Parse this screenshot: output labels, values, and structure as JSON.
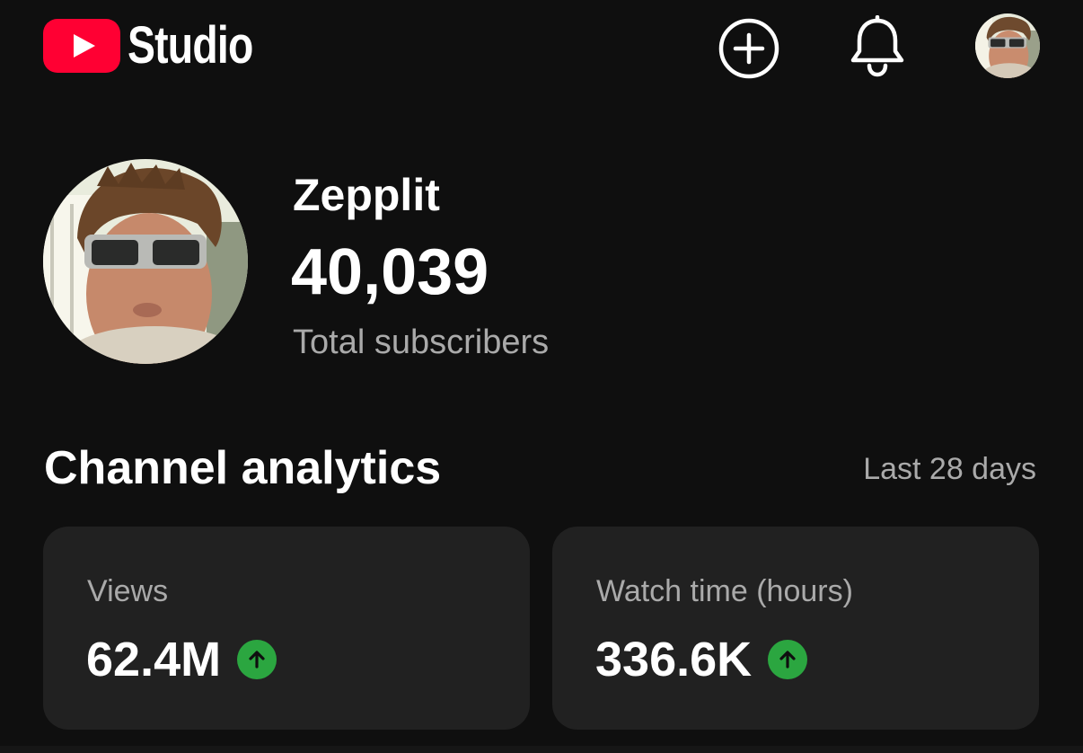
{
  "app": {
    "logo_text": "Studio",
    "logo_icon": "youtube-play-icon",
    "brand_color": "#ff0033"
  },
  "topbar": {
    "create_icon": "plus-circle-icon",
    "notifications_icon": "bell-icon",
    "account_icon": "avatar"
  },
  "channel": {
    "name": "Zepplit",
    "subscriber_count": "40,039",
    "subscriber_label": "Total subscribers"
  },
  "analytics": {
    "title": "Channel analytics",
    "period": "Last 28 days",
    "trend_color": "#2ba640",
    "cards": [
      {
        "label": "Views",
        "value": "62.4M",
        "trend": "up",
        "trend_icon": "arrow-up-icon"
      },
      {
        "label": "Watch time (hours)",
        "value": "336.6K",
        "trend": "up",
        "trend_icon": "arrow-up-icon"
      }
    ]
  }
}
